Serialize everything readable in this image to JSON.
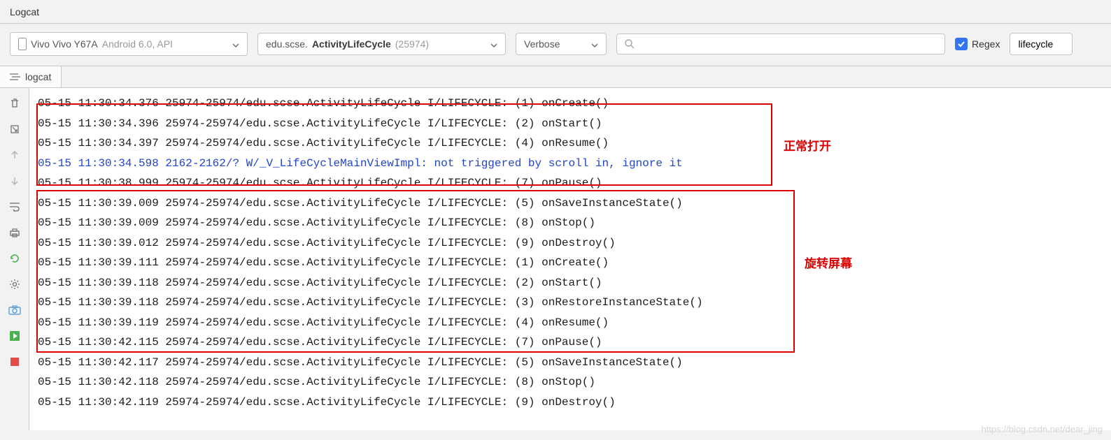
{
  "header": {
    "title": "Logcat"
  },
  "toolbar": {
    "device": {
      "name": "Vivo Vivo Y67A",
      "suffix": "Android 6.0, API"
    },
    "process": {
      "prefix": "edu.scse.",
      "bold": "ActivityLifeCycle",
      "pid": "(25974)"
    },
    "level": "Verbose",
    "search": {
      "placeholder": ""
    },
    "regex_label": "Regex",
    "filter_value": "lifecycle"
  },
  "tabs": {
    "logcat": "logcat"
  },
  "annotations": {
    "open": "正常打开",
    "rotate": "旋转屏幕"
  },
  "log": [
    {
      "t": "05-15 11:30:34.376 25974-25974/edu.scse.ActivityLifeCycle I/LIFECYCLE: (1) onCreate()",
      "c": "n"
    },
    {
      "t": "05-15 11:30:34.396 25974-25974/edu.scse.ActivityLifeCycle I/LIFECYCLE: (2) onStart()",
      "c": "n"
    },
    {
      "t": "05-15 11:30:34.397 25974-25974/edu.scse.ActivityLifeCycle I/LIFECYCLE: (4) onResume()",
      "c": "n"
    },
    {
      "t": "05-15 11:30:34.598 2162-2162/? W/_V_LifeCycleMainViewImpl: not triggered by scroll in, ignore it",
      "c": "b"
    },
    {
      "t": "05-15 11:30:38.999 25974-25974/edu.scse.ActivityLifeCycle I/LIFECYCLE: (7) onPause()",
      "c": "n"
    },
    {
      "t": "05-15 11:30:39.009 25974-25974/edu.scse.ActivityLifeCycle I/LIFECYCLE: (5) onSaveInstanceState()",
      "c": "n"
    },
    {
      "t": "05-15 11:30:39.009 25974-25974/edu.scse.ActivityLifeCycle I/LIFECYCLE: (8) onStop()",
      "c": "n"
    },
    {
      "t": "05-15 11:30:39.012 25974-25974/edu.scse.ActivityLifeCycle I/LIFECYCLE: (9) onDestroy()",
      "c": "n"
    },
    {
      "t": "05-15 11:30:39.111 25974-25974/edu.scse.ActivityLifeCycle I/LIFECYCLE: (1) onCreate()",
      "c": "n"
    },
    {
      "t": "05-15 11:30:39.118 25974-25974/edu.scse.ActivityLifeCycle I/LIFECYCLE: (2) onStart()",
      "c": "n"
    },
    {
      "t": "05-15 11:30:39.118 25974-25974/edu.scse.ActivityLifeCycle I/LIFECYCLE: (3) onRestoreInstanceState()",
      "c": "n"
    },
    {
      "t": "05-15 11:30:39.119 25974-25974/edu.scse.ActivityLifeCycle I/LIFECYCLE: (4) onResume()",
      "c": "n"
    },
    {
      "t": "05-15 11:30:42.115 25974-25974/edu.scse.ActivityLifeCycle I/LIFECYCLE: (7) onPause()",
      "c": "n"
    },
    {
      "t": "05-15 11:30:42.117 25974-25974/edu.scse.ActivityLifeCycle I/LIFECYCLE: (5) onSaveInstanceState()",
      "c": "n"
    },
    {
      "t": "05-15 11:30:42.118 25974-25974/edu.scse.ActivityLifeCycle I/LIFECYCLE: (8) onStop()",
      "c": "n"
    },
    {
      "t": "05-15 11:30:42.119 25974-25974/edu.scse.ActivityLifeCycle I/LIFECYCLE: (9) onDestroy()",
      "c": "n"
    }
  ],
  "watermark": "https://blog.csdn.net/dear_jing"
}
